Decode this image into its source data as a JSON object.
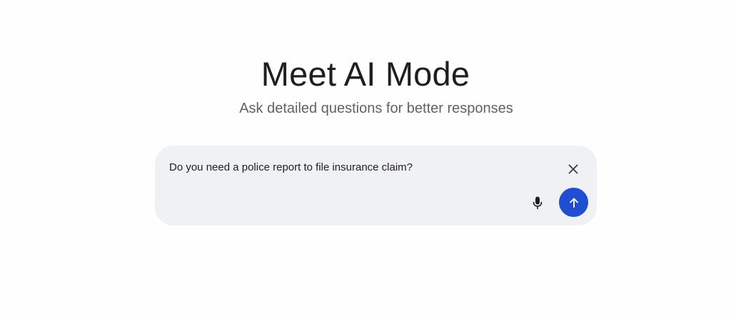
{
  "hero": {
    "title": "Meet AI Mode",
    "subtitle": "Ask detailed questions for better responses"
  },
  "search": {
    "query": "Do you need a police report to file insurance claim?",
    "clear_icon": "close-icon",
    "mic_icon": "mic-icon",
    "send_icon": "arrow-up-icon"
  },
  "colors": {
    "send_button": "#1f4fd0",
    "search_background": "#f0f1f4",
    "title_text": "#1f1f1f",
    "subtitle_text": "#5f6368"
  }
}
